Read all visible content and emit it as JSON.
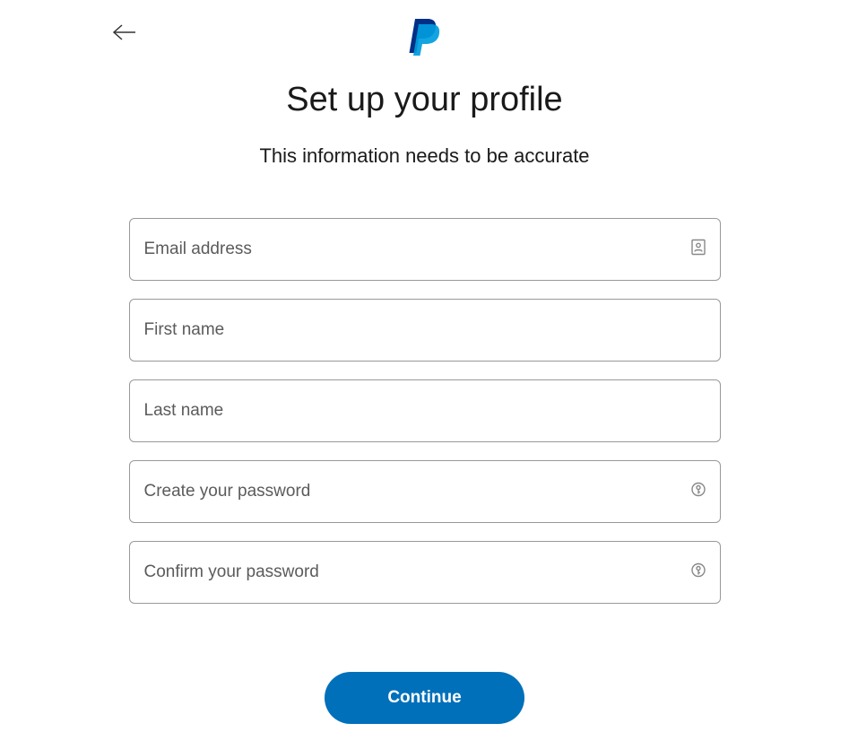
{
  "header": {
    "title": "Set up your profile",
    "subtitle": "This information needs to be accurate"
  },
  "form": {
    "email": {
      "placeholder": "Email address"
    },
    "first_name": {
      "placeholder": "First name"
    },
    "last_name": {
      "placeholder": "Last name"
    },
    "password": {
      "placeholder": "Create your password"
    },
    "confirm_password": {
      "placeholder": "Confirm your password"
    },
    "submit_label": "Continue"
  },
  "colors": {
    "primary": "#0070ba",
    "logo_dark": "#002f86",
    "logo_light": "#009cde"
  }
}
